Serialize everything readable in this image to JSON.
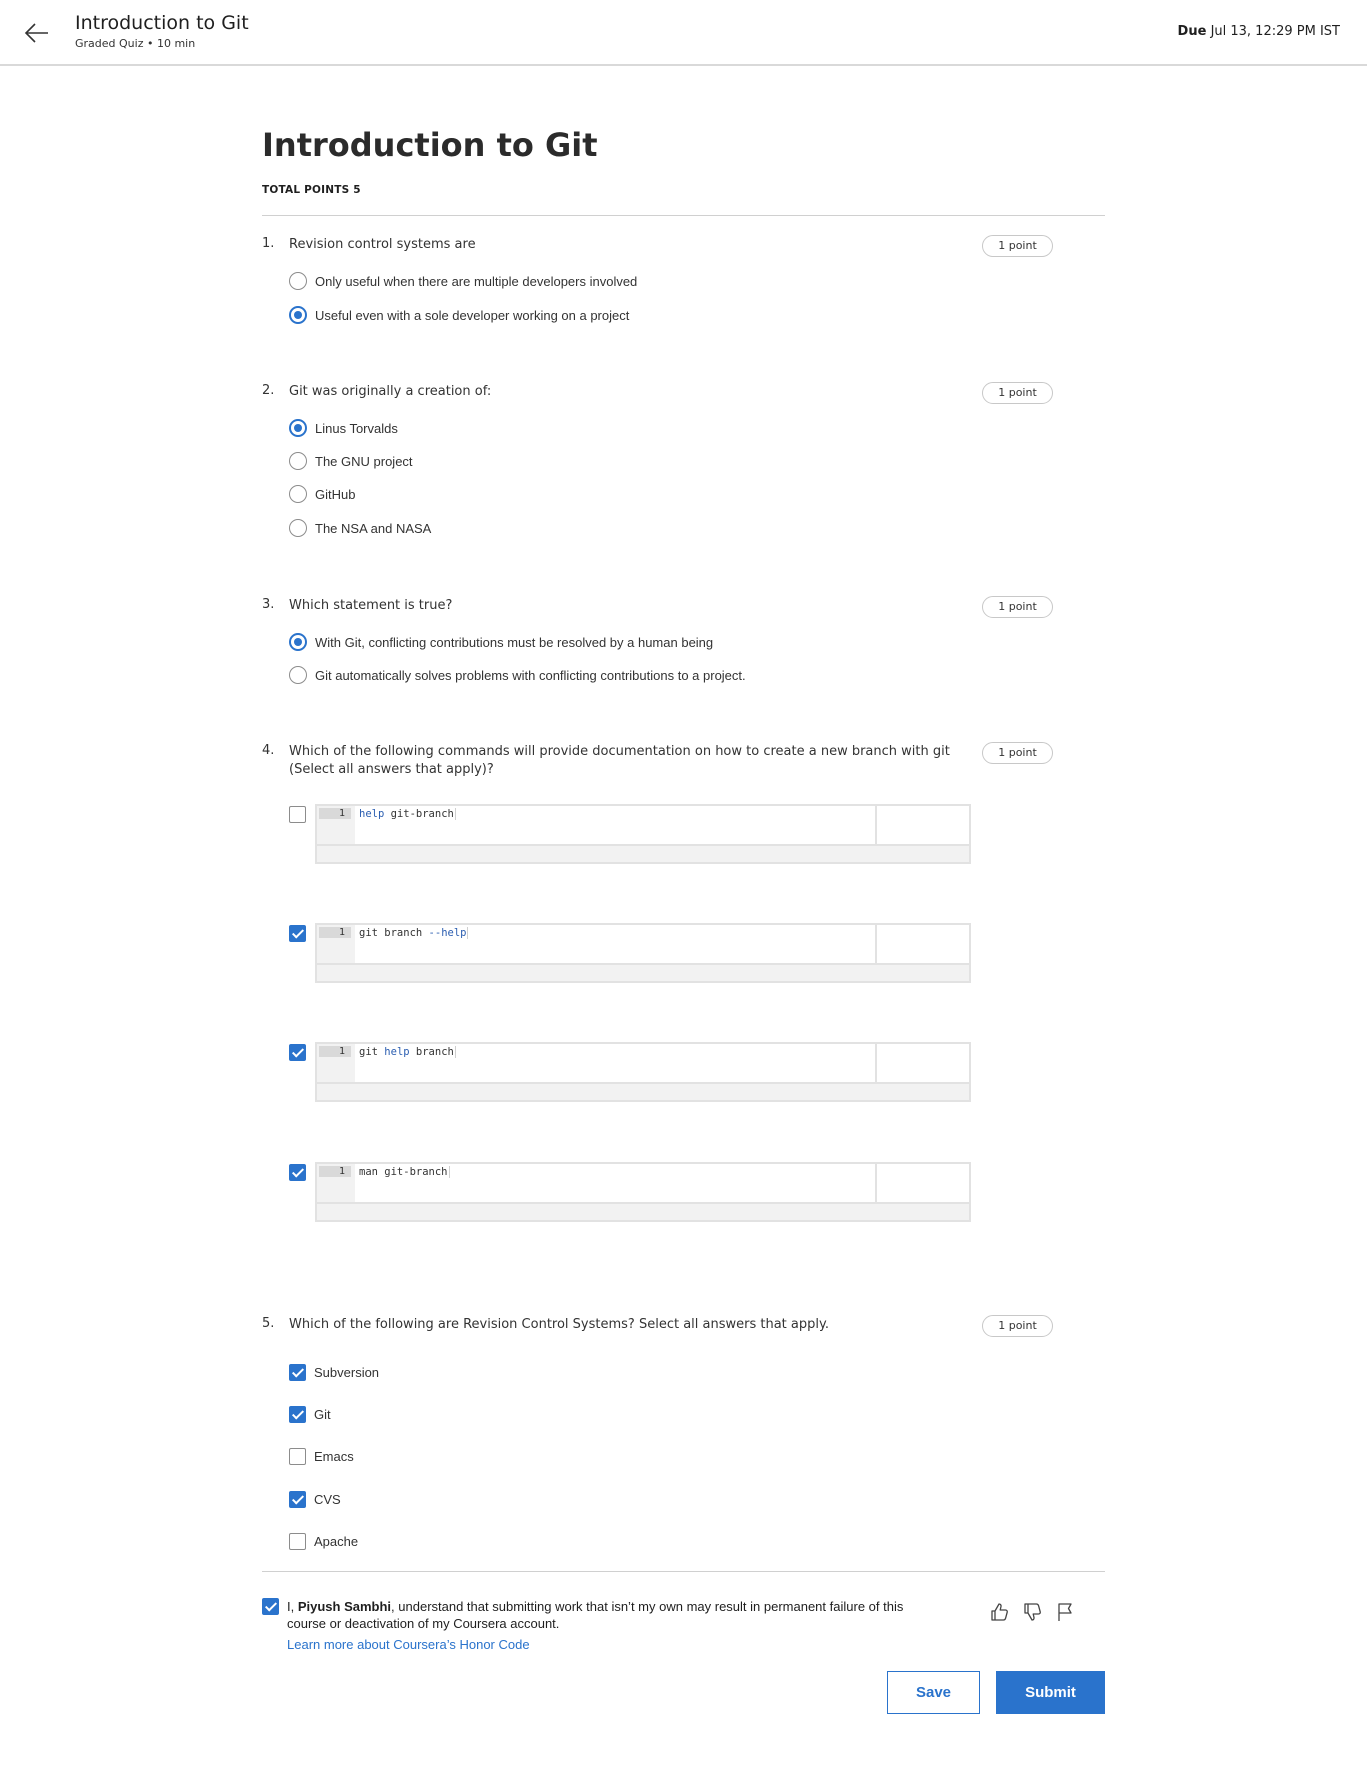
{
  "header": {
    "title": "Introduction to Git",
    "subtitle": "Graded Quiz • 10 min",
    "due_label": "Due",
    "due_value": "Jul 13, 12:29 PM IST"
  },
  "quiz": {
    "title": "Introduction to Git",
    "total_points": "TOTAL POINTS 5"
  },
  "questions": [
    {
      "number": "1.",
      "text": "Revision control systems are",
      "points": "1 point",
      "type": "radio",
      "options": [
        {
          "label": "Only useful when there are multiple developers involved",
          "selected": false
        },
        {
          "label": "Useful even with a sole developer working on a project",
          "selected": true
        }
      ]
    },
    {
      "number": "2.",
      "text": "Git was originally a creation of:",
      "points": "1 point",
      "type": "radio",
      "options": [
        {
          "label": "Linus Torvalds",
          "selected": true
        },
        {
          "label": "The GNU project",
          "selected": false
        },
        {
          "label": "GitHub",
          "selected": false
        },
        {
          "label": "The NSA and NASA",
          "selected": false
        }
      ]
    },
    {
      "number": "3.",
      "text": "Which statement is true?",
      "points": "1 point",
      "type": "radio",
      "options": [
        {
          "label": "With Git, conflicting contributions must be resolved by a human being",
          "selected": true
        },
        {
          "label": "Git automatically solves problems with conflicting contributions to a project.",
          "selected": false
        }
      ]
    },
    {
      "number": "4.",
      "text": "Which of the following commands will provide documentation on how to create a new branch with git (Select all answers that apply)?",
      "points": "1 point",
      "type": "code-checkbox",
      "options": [
        {
          "line_number": "1",
          "code_parts": [
            {
              "t": "help",
              "kw": true
            },
            {
              "t": " git-branch",
              "kw": false
            }
          ],
          "selected": false
        },
        {
          "line_number": "1",
          "code_parts": [
            {
              "t": "git branch ",
              "kw": false
            },
            {
              "t": "--help",
              "kw": true
            }
          ],
          "selected": true
        },
        {
          "line_number": "1",
          "code_parts": [
            {
              "t": "git ",
              "kw": false
            },
            {
              "t": "help",
              "kw": true
            },
            {
              "t": " branch",
              "kw": false
            }
          ],
          "selected": true
        },
        {
          "line_number": "1",
          "code_parts": [
            {
              "t": "man git-branch",
              "kw": false
            }
          ],
          "selected": true
        }
      ]
    },
    {
      "number": "5.",
      "text": "Which of the following are Revision Control Systems? Select all answers that apply.",
      "points": "1 point",
      "type": "checkbox",
      "options": [
        {
          "label": "Subversion",
          "selected": true
        },
        {
          "label": "Git",
          "selected": true
        },
        {
          "label": "Emacs",
          "selected": false
        },
        {
          "label": "CVS",
          "selected": true
        },
        {
          "label": "Apache",
          "selected": false
        }
      ]
    }
  ],
  "honor": {
    "checked": true,
    "prefix": "I, ",
    "name": "Piyush Sambhi",
    "suffix": ", understand that submitting work that isn’t my own may result in permanent failure of this course or deactivation of my Coursera account.",
    "link": "Learn more about Coursera’s Honor Code"
  },
  "feedback_icons": [
    "thumbs-up-icon",
    "thumbs-down-icon",
    "flag-icon"
  ],
  "buttons": {
    "save": "Save",
    "submit": "Submit"
  },
  "colors": {
    "accent": "#2a73cc"
  }
}
